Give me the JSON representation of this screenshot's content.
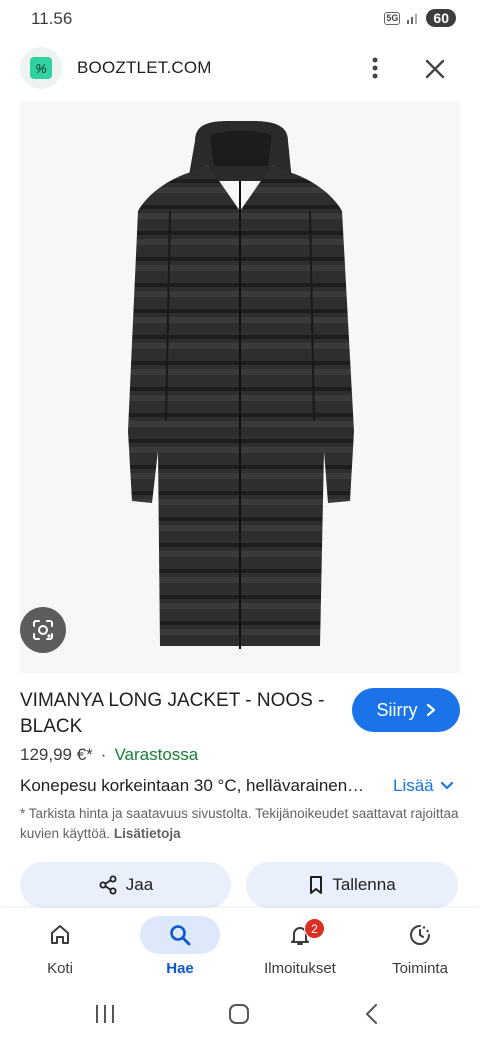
{
  "status_bar": {
    "time": "11.56",
    "network": "5G",
    "battery": "60"
  },
  "header": {
    "site_name": "BOOZTLET.COM",
    "logo_text": "%"
  },
  "product": {
    "title": "VIMANYA LONG JACKET - NOOS - BLACK",
    "price": "129,99 €*",
    "separator": "·",
    "availability": "Varastossa",
    "description": "Konepesu korkeintaan 30 °C, hellävarainen…",
    "more_label": "Lisää",
    "disclaimer": "* Tarkista hinta ja saatavuus sivustolta. Tekijänoikeudet saattavat rajoittaa kuvien käyttöä.",
    "disclaimer_link": "Lisätietoja",
    "go_label": "Siirry"
  },
  "actions": {
    "share_label": "Jaa",
    "save_label": "Tallenna"
  },
  "bottom_nav": {
    "items": [
      {
        "label": "Koti",
        "icon": "home-icon"
      },
      {
        "label": "Hae",
        "icon": "search-icon",
        "active": true
      },
      {
        "label": "Ilmoitukset",
        "icon": "bell-icon",
        "badge": "2"
      },
      {
        "label": "Toiminta",
        "icon": "activity-icon"
      }
    ]
  },
  "colors": {
    "accent": "#1a73e8",
    "stock": "#188038",
    "pill": "#e9f0fb",
    "badge": "#d93025"
  }
}
